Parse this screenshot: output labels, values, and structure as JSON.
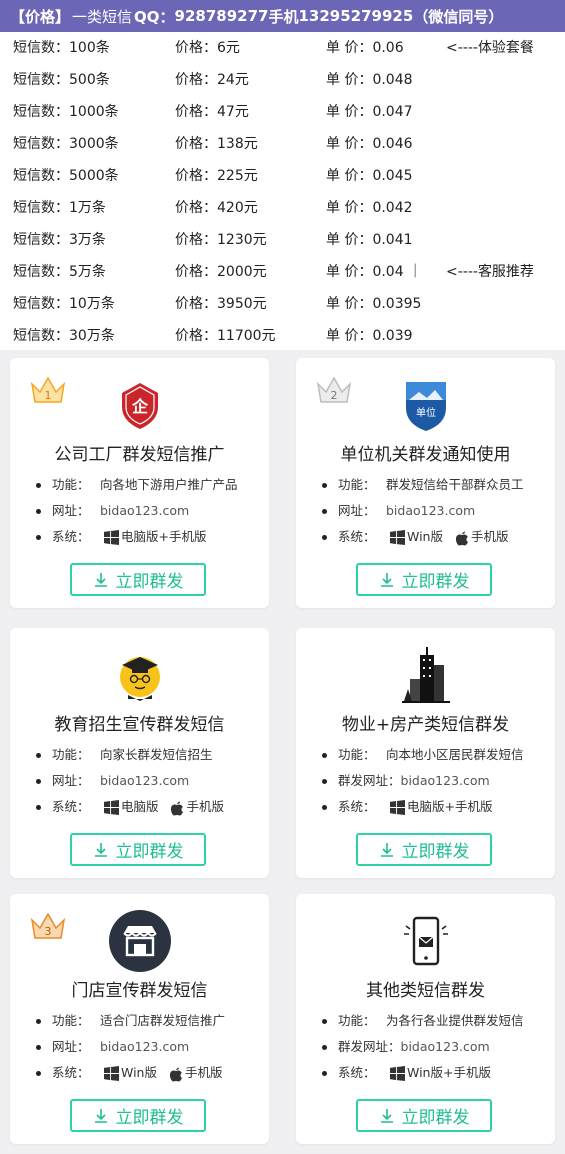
{
  "banner": {
    "prefix": "【价格】",
    "service": "一类短信",
    "qq_label": "QQ：",
    "qq": "928789277",
    "phone_label": "手机",
    "phone": "13295279925",
    "note": "（微信同号）"
  },
  "price_rows": [
    {
      "count": "短信数：100条",
      "price": "价格：6元",
      "unit": "单 价：0.06",
      "note": "<----体验套餐"
    },
    {
      "count": "短信数：500条",
      "price": "价格：24元",
      "unit": "单 价：0.048",
      "note": ""
    },
    {
      "count": "短信数：1000条",
      "price": "价格：47元",
      "unit": "单 价：0.047",
      "note": ""
    },
    {
      "count": "短信数：3000条",
      "price": "价格：138元",
      "unit": "单 价：0.046",
      "note": ""
    },
    {
      "count": "短信数：5000条",
      "price": "价格：225元",
      "unit": "单 价：0.045",
      "note": ""
    },
    {
      "count": "短信数：1万条",
      "price": "价格：420元",
      "unit": "单 价：0.042",
      "note": ""
    },
    {
      "count": "短信数：3万条",
      "price": "价格：1230元",
      "unit": "单 价：0.041",
      "note": ""
    },
    {
      "count": "短信数：5万条",
      "price": "价格：2000元",
      "unit": "单 价：0.04 ｜",
      "note": "<----客服推荐"
    },
    {
      "count": "短信数：10万条",
      "price": "价格：3950元",
      "unit": "单 价：0.0395",
      "note": ""
    },
    {
      "count": "短信数：30万条",
      "price": "价格：11700元",
      "unit": "单 价：0.039",
      "note": ""
    }
  ],
  "cards": [
    {
      "rank": "1",
      "icon": "company-shield-icon",
      "title": "公司工厂群发短信推广",
      "func_label": "功能：",
      "func": "向各地下游用户推广产品",
      "url_label": "网址：",
      "url": "bidao123.com",
      "sys_label": "系统：",
      "sys_a": "电脑版+手机版",
      "sys_b": "",
      "shield_text": "企",
      "btn": "立即群发"
    },
    {
      "rank": "2",
      "icon": "unit-badge-icon",
      "title": "单位机关群发通知使用",
      "func_label": "功能：",
      "func": "群发短信给干部群众员工",
      "url_label": "网址：",
      "url": "bidao123.com",
      "sys_label": "系统：",
      "sys_a": "Win版",
      "sys_b": "手机版",
      "shield_text": "单位",
      "btn": "立即群发"
    },
    {
      "rank": "",
      "icon": "graduate-icon",
      "title": "教育招生宣传群发短信",
      "func_label": "功能：",
      "func": "向家长群发短信招生",
      "url_label": "网址：",
      "url": "bidao123.com",
      "sys_label": "系统：",
      "sys_a": "电脑版",
      "sys_b": "手机版",
      "btn": "立即群发"
    },
    {
      "rank": "",
      "icon": "buildings-icon",
      "title": "物业+房产类短信群发",
      "func_label": "功能：",
      "func": "向本地小区居民群发短信",
      "url_label": "群发网址：",
      "url": "bidao123.com",
      "sys_label": "系统：",
      "sys_a": "电脑版+手机版",
      "sys_b": "",
      "btn": "立即群发"
    },
    {
      "rank": "3",
      "icon": "storefront-icon",
      "title": "门店宣传群发短信",
      "func_label": "功能：",
      "func": "适合门店群发短信推广",
      "url_label": "网址：",
      "url": "bidao123.com",
      "sys_label": "系统：",
      "sys_a": "Win版",
      "sys_b": "手机版",
      "btn": "立即群发"
    },
    {
      "rank": "",
      "icon": "phone-message-icon",
      "title": "其他类短信群发",
      "func_label": "功能：",
      "func": "为各行各业提供群发短信",
      "url_label": "群发网址：",
      "url": "bidao123.com",
      "sys_label": "系统：",
      "sys_a": "Win版+手机版",
      "sys_b": "",
      "btn": "立即群发"
    }
  ],
  "colors": {
    "banner": "#6c66b6",
    "accent": "#2ed2a7",
    "gold": "#f5a623",
    "silver": "#bdbdbd"
  }
}
